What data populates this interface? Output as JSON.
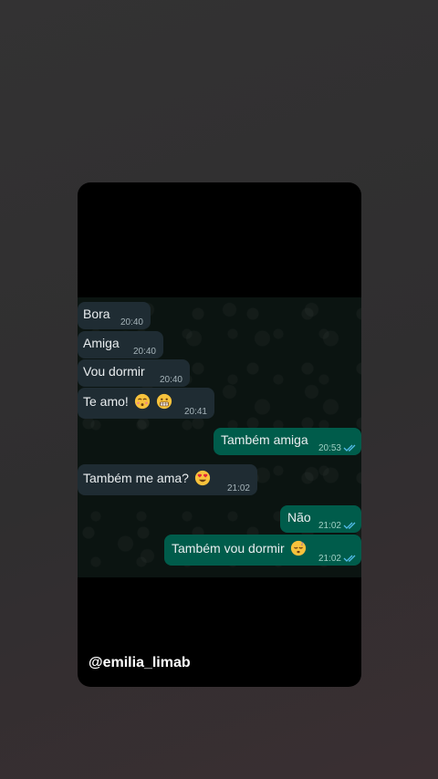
{
  "messages": [
    {
      "text": "Bora",
      "time": "20:40",
      "direction": "in"
    },
    {
      "text": "Amiga",
      "time": "20:40",
      "direction": "in"
    },
    {
      "text": "Vou dormir",
      "time": "20:40",
      "direction": "in"
    },
    {
      "text": "Te amo!",
      "time": "20:41",
      "direction": "in",
      "emoji": [
        "kissing-face-icon",
        "grimacing-face-icon"
      ]
    },
    {
      "text": "Também amiga",
      "time": "20:53",
      "direction": "out",
      "status": "read"
    },
    {
      "text": "Também me ama?",
      "time": "21:02",
      "direction": "in",
      "emoji": [
        "heart-eyes-face-icon"
      ]
    },
    {
      "text": "Não",
      "time": "21:02",
      "direction": "out",
      "status": "read"
    },
    {
      "text": "Também vou dormir",
      "time": "21:02",
      "direction": "out",
      "status": "read",
      "emoji": [
        "sleeping-face-icon"
      ]
    }
  ],
  "username": "@emilia_limab",
  "colors": {
    "incoming_bubble": "#1f2c33",
    "outgoing_bubble": "#005c4b",
    "read_ticks": "#53bdeb",
    "chat_background": "#0b1411"
  }
}
